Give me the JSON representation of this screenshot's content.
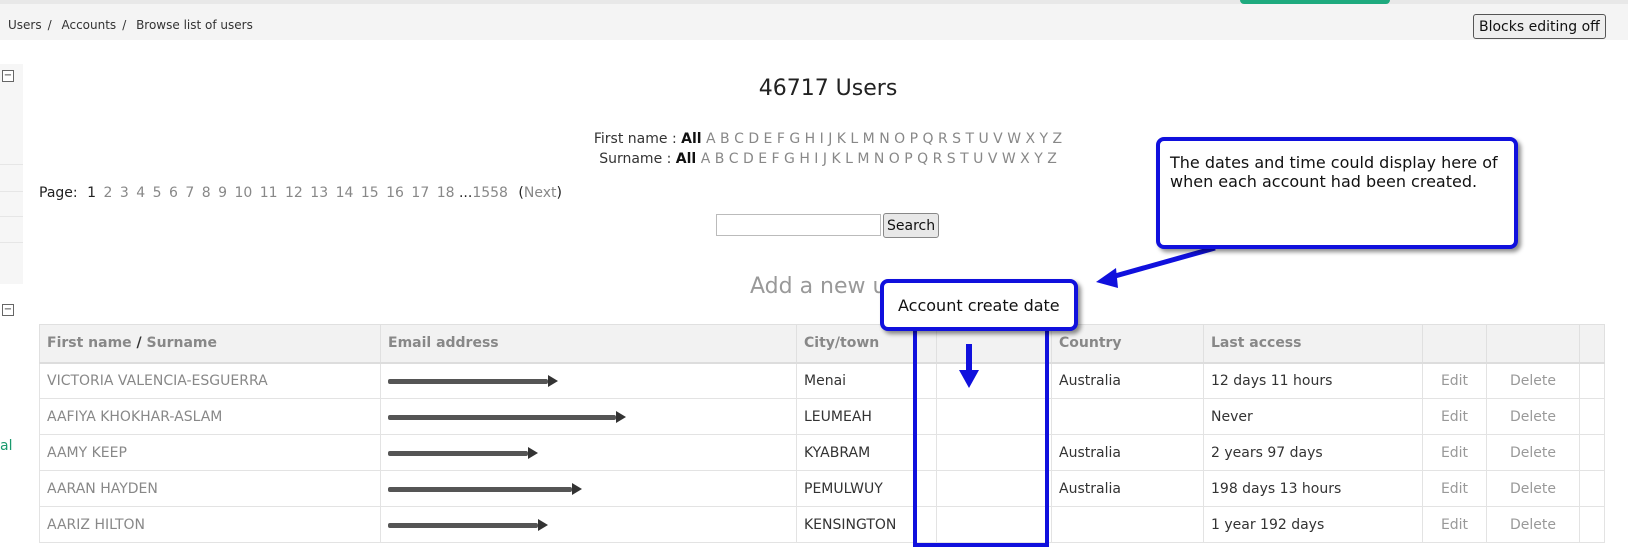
{
  "breadcrumb": [
    "Users",
    "Accounts",
    "Browse list of users"
  ],
  "blocks_button": "Blocks editing off",
  "page_title": "46717 Users",
  "first_name_filter": {
    "label": "First name :",
    "selected": "All",
    "letters": "A B C D E F G H I J K L M N O P Q R S T U V W X Y Z"
  },
  "surname_filter": {
    "label": "Surname :",
    "selected": "All",
    "letters": "A B C D E F G H I J K L M N O P Q R S T U V W X Y Z"
  },
  "paging": {
    "label": "Page:",
    "current": "1",
    "pages": [
      "2",
      "3",
      "4",
      "5",
      "6",
      "7",
      "8",
      "9",
      "10",
      "11",
      "12",
      "13",
      "14",
      "15",
      "16",
      "17",
      "18"
    ],
    "ellipsis": "...",
    "last": "1558",
    "next": "Next"
  },
  "search": {
    "button": "Search"
  },
  "add_new": "Add a new us",
  "table": {
    "headers": {
      "first": "First name",
      "slash": "/",
      "surname": "Surname",
      "email": "Email address",
      "city": "City/town",
      "country": "Country",
      "last_access": "Last access"
    },
    "rows": [
      {
        "name": "VICTORIA VALENCIA-ESGUERRA",
        "city": "Menai",
        "country": "Australia",
        "last_access": "12 days 11 hours",
        "edit": "Edit",
        "delete": "Delete"
      },
      {
        "name": "AAFIYA KHOKHAR-ASLAM",
        "city": "LEUMEAH",
        "country": "",
        "last_access": "Never",
        "edit": "Edit",
        "delete": "Delete"
      },
      {
        "name": "AAMY KEEP",
        "city": "KYABRAM",
        "country": "Australia",
        "last_access": "2 years 97 days",
        "edit": "Edit",
        "delete": "Delete"
      },
      {
        "name": "AARAN HAYDEN",
        "city": "PEMULWUY",
        "country": "Australia",
        "last_access": "198 days 13 hours",
        "edit": "Edit",
        "delete": "Delete"
      },
      {
        "name": "AARIZ HILTON",
        "city": "KENSINGTON",
        "country": "",
        "last_access": "1 year 192 days",
        "edit": "Edit",
        "delete": "Delete"
      }
    ]
  },
  "callout_dates": "The dates and time could display here of when each account had been created.",
  "callout_create": "Account create date",
  "left_text": "al",
  "colors": {
    "annotation_blue": "#1010dd",
    "accent_green": "#1eaa7e",
    "link_grey": "#888888"
  }
}
